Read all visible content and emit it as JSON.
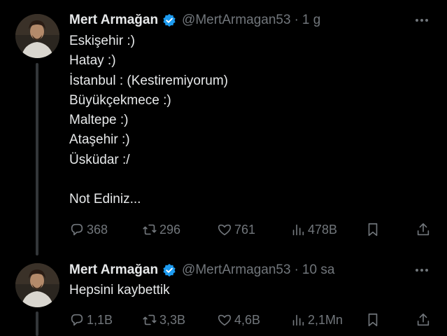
{
  "tweets": [
    {
      "author_name": "Mert Armağan",
      "handle": "@MertArmagan53",
      "separator": "·",
      "time": "1 g",
      "lines": [
        "Eskişehir :)",
        "Hatay :)",
        "İstanbul : (Kestiremiyorum)",
        "Büyükçekmece :)",
        "Maltepe :)",
        "Ataşehir :)",
        "Üsküdar :/",
        "",
        "Not Ediniz..."
      ],
      "replies": "368",
      "retweets": "296",
      "likes": "761",
      "views": "478B"
    },
    {
      "author_name": "Mert Armağan",
      "handle": "@MertArmagan53",
      "separator": "·",
      "time": "10 sa",
      "lines": [
        "Hepsini kaybettik"
      ],
      "replies": "1,1B",
      "retweets": "3,3B",
      "likes": "4,6B",
      "views": "2,1Mn"
    }
  ],
  "icons": {
    "verified": "verified-badge-icon",
    "more": "more-options-icon",
    "reply": "reply-icon",
    "retweet": "retweet-icon",
    "like": "like-icon",
    "views": "views-icon",
    "bookmark": "bookmark-icon",
    "share": "share-icon"
  },
  "colors": {
    "background": "#000000",
    "text": "#e7e9ea",
    "secondary": "#71767b",
    "verified": "#1d9bf0",
    "thread_line": "#333639"
  }
}
